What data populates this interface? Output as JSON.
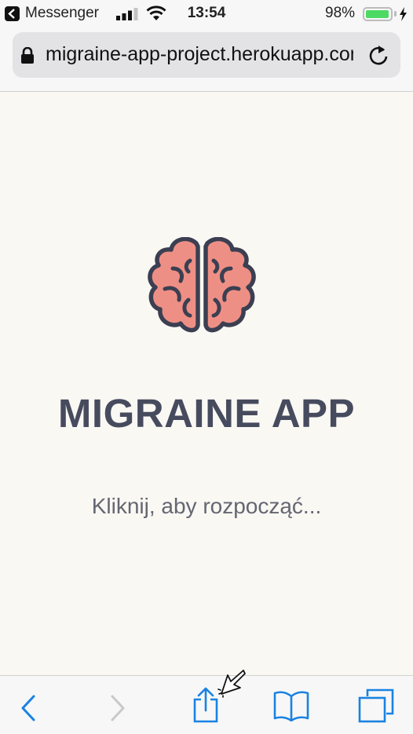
{
  "status_bar": {
    "back_app_label": "Messenger",
    "time": "13:54",
    "battery_percent": "98%",
    "battery_level": 0.98,
    "signal_bars": 3
  },
  "browser": {
    "url": "migraine-app-project.herokuapp.com",
    "secure": true
  },
  "page": {
    "title": "MIGRAINE APP",
    "tagline": "Kliknij, aby rozpocząć...",
    "logo_icon": "brain-icon",
    "accent_color": "#ee8f85",
    "title_color": "#474b5e",
    "background_color": "#faf8f3"
  },
  "toolbar": {
    "items": [
      "back-icon",
      "forward-icon",
      "share-icon",
      "bookmarks-icon",
      "tabs-icon"
    ],
    "forward_enabled": false,
    "accent_color": "#1a82e2"
  }
}
